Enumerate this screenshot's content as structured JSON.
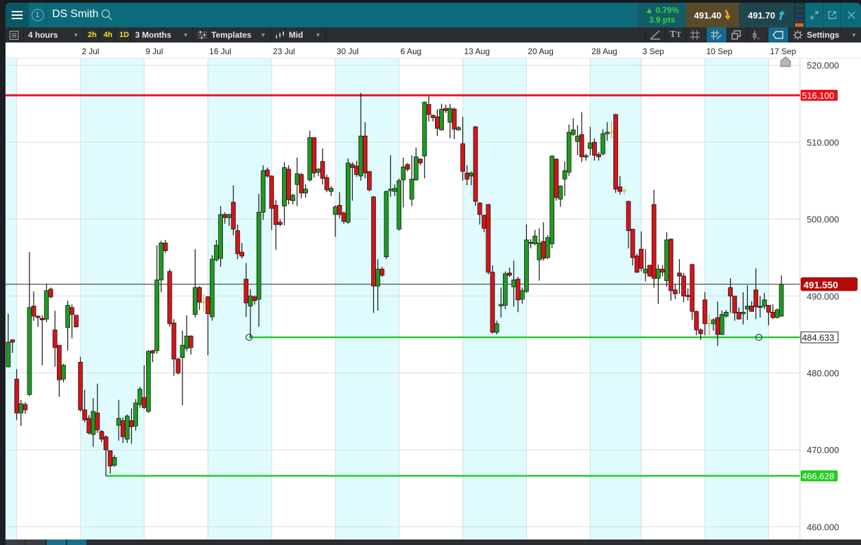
{
  "header": {
    "workspace_number": "1",
    "title": "DS Smith",
    "change_pct": "0.79%",
    "change_pts": "3.9 pts",
    "sell_price": "491.40",
    "buy_price": "491.70"
  },
  "toolbar": {
    "interval": "4 hours",
    "quick_intervals": [
      "2h",
      "4h",
      "1D"
    ],
    "range": "3 Months",
    "templates": "Templates",
    "price_type": "Mid",
    "settings": "Settings"
  },
  "colors": {
    "up": "#1f9a22",
    "down": "#d3151a",
    "doji": "#e0a030",
    "resistance": "#e8141c",
    "support": "#22cc22",
    "current": "#b30a0a",
    "band": "#dffbfd"
  },
  "chart_data": {
    "type": "candlestick",
    "title": "DS Smith",
    "timeframe": "4 hours",
    "x_ticks": [
      {
        "label": "2 Jul",
        "index": 17
      },
      {
        "label": "9 Jul",
        "index": 32
      },
      {
        "label": "16 Jul",
        "index": 47
      },
      {
        "label": "23 Jul",
        "index": 62
      },
      {
        "label": "30 Jul",
        "index": 77
      },
      {
        "label": "6 Aug",
        "index": 92
      },
      {
        "label": "13 Aug",
        "index": 107
      },
      {
        "label": "20 Aug",
        "index": 122
      },
      {
        "label": "28 Aug",
        "index": 137
      },
      {
        "label": "3 Sep",
        "index": 149
      },
      {
        "label": "10 Sep",
        "index": 164
      },
      {
        "label": "17 Sep",
        "index": 179
      }
    ],
    "y_ticks": [
      {
        "label": "520.000",
        "value": 520
      },
      {
        "label": "510.000",
        "value": 510
      },
      {
        "label": "500.000",
        "value": 500
      },
      {
        "label": "490.000",
        "value": 490
      },
      {
        "label": "480.000",
        "value": 480
      },
      {
        "label": "470.000",
        "value": 470
      },
      {
        "label": "460.000",
        "value": 460
      }
    ],
    "ylim": [
      458.35,
      520.9
    ],
    "current_price": {
      "label": "491.550",
      "value": 491.55
    },
    "levels": [
      {
        "label": "516.100",
        "value": 516.1,
        "kind": "resistance",
        "from_index": -1,
        "to_index": null
      },
      {
        "label": "484.633",
        "value": 484.633,
        "kind": "support",
        "from_index": 56.7,
        "to_index": null,
        "anchors": [
          56.7,
          176.7
        ]
      },
      {
        "label": "466.628",
        "value": 466.628,
        "kind": "support",
        "from_index": 23,
        "to_index": null
      }
    ],
    "candle_fields": [
      "open",
      "high",
      "low",
      "close"
    ],
    "candles": [
      [
        480.8,
        487.7,
        480.7,
        484.0
      ],
      [
        484.3,
        484.4,
        482.6,
        484.0
      ],
      [
        479.2,
        480.5,
        473.9,
        474.8
      ],
      [
        474.8,
        476.5,
        473.1,
        476.0
      ],
      [
        475.9,
        476.2,
        474.7,
        475.2
      ],
      [
        477.2,
        495.7,
        477.0,
        488.5
      ],
      [
        488.7,
        490.6,
        486.8,
        487.4
      ],
      [
        487.4,
        487.4,
        486.0,
        487.2
      ],
      [
        487.1,
        487.5,
        481.0,
        486.9
      ],
      [
        487.0,
        491.6,
        486.6,
        490.7
      ],
      [
        490.9,
        491.1,
        489.7,
        489.9
      ],
      [
        485.6,
        488.1,
        480.8,
        483.3
      ],
      [
        483.6,
        483.6,
        476.9,
        479.1
      ],
      [
        479.2,
        481.2,
        478.8,
        481.0
      ],
      [
        485.9,
        489.4,
        482.9,
        488.8
      ],
      [
        488.5,
        488.9,
        484.5,
        487.6
      ],
      [
        487.5,
        487.5,
        485.9,
        486.0
      ],
      [
        481.4,
        482.1,
        475.0,
        475.2
      ],
      [
        475.2,
        477.8,
        473.6,
        473.9
      ],
      [
        474.1,
        474.5,
        472.0,
        472.2
      ],
      [
        472.0,
        476.7,
        470.4,
        475.0
      ],
      [
        474.8,
        478.6,
        472.2,
        472.6
      ],
      [
        472.4,
        472.6,
        471.0,
        471.4
      ],
      [
        471.7,
        471.9,
        466.6,
        470.0
      ],
      [
        469.9,
        469.9,
        466.9,
        467.9
      ],
      [
        468.0,
        469.3,
        467.8,
        469.0
      ],
      [
        473.2,
        476.5,
        471.2,
        474.1
      ],
      [
        473.8,
        474.2,
        470.9,
        471.7
      ],
      [
        471.4,
        474.6,
        470.9,
        474.4
      ],
      [
        473.8,
        475.4,
        470.8,
        473.0
      ],
      [
        473.1,
        476.6,
        472.5,
        476.1
      ],
      [
        475.9,
        478.2,
        475.5,
        477.9
      ],
      [
        476.8,
        481.0,
        475.3,
        475.5
      ],
      [
        475.0,
        483.0,
        474.8,
        482.8
      ],
      [
        482.9,
        483.0,
        481.4,
        482.6
      ],
      [
        482.9,
        496.6,
        482.5,
        492.1
      ],
      [
        492.1,
        497.2,
        490.5,
        496.9
      ],
      [
        496.9,
        497.3,
        495.6,
        495.9
      ],
      [
        493.2,
        493.5,
        486.0,
        486.4
      ],
      [
        486.5,
        487.0,
        479.6,
        481.8
      ],
      [
        481.8,
        482.0,
        479.8,
        480.0
      ],
      [
        482.0,
        485.5,
        475.8,
        483.6
      ],
      [
        483.2,
        487.5,
        482.8,
        484.8
      ],
      [
        484.8,
        484.9,
        482.4,
        483.3
      ],
      [
        487.6,
        496.1,
        487.2,
        491.1
      ],
      [
        491.1,
        491.3,
        488.2,
        489.2
      ],
      [
        489.2,
        490.2,
        488.0,
        489.2
      ],
      [
        489.9,
        490.0,
        482.3,
        487.7
      ],
      [
        487.3,
        495.3,
        486.8,
        494.8
      ],
      [
        494.7,
        497.3,
        494.5,
        496.6
      ],
      [
        494.9,
        501.7,
        493.8,
        500.6
      ],
      [
        500.6,
        500.9,
        499.4,
        500.2
      ],
      [
        500.2,
        500.7,
        499.1,
        500.6
      ],
      [
        502.2,
        504.4,
        497.9,
        498.7
      ],
      [
        498.5,
        499.3,
        494.8,
        495.5
      ],
      [
        495.7,
        496.9,
        494.9,
        495.2
      ],
      [
        492.2,
        494.3,
        487.3,
        489.1
      ],
      [
        488.7,
        490.9,
        484.6,
        490.0
      ],
      [
        489.9,
        490.1,
        488.9,
        489.4
      ],
      [
        489.6,
        503.3,
        486.0,
        500.9
      ],
      [
        500.9,
        507.0,
        499.9,
        506.3
      ],
      [
        506.4,
        506.7,
        505.4,
        505.6
      ],
      [
        505.6,
        505.7,
        498.6,
        501.4
      ],
      [
        501.8,
        502.5,
        496.0,
        499.3
      ],
      [
        499.6,
        500.0,
        499.1,
        499.3
      ],
      [
        501.7,
        507.4,
        499.2,
        506.7
      ],
      [
        506.5,
        507.0,
        501.9,
        502.5
      ],
      [
        502.4,
        503.3,
        501.9,
        503.1
      ],
      [
        504.5,
        508.0,
        501.7,
        505.9
      ],
      [
        505.8,
        506.0,
        502.7,
        503.4
      ],
      [
        503.4,
        504.5,
        502.8,
        503.9
      ],
      [
        505.1,
        511.5,
        504.9,
        510.6
      ],
      [
        510.6,
        510.6,
        505.4,
        506.0
      ],
      [
        506.1,
        506.6,
        505.6,
        506.5
      ],
      [
        507.5,
        509.2,
        504.5,
        505.3
      ],
      [
        505.4,
        505.8,
        503.5,
        503.8
      ],
      [
        503.6,
        504.3,
        503.0,
        504.0
      ],
      [
        500.6,
        501.8,
        497.7,
        501.6
      ],
      [
        501.8,
        503.5,
        500.1,
        500.6
      ],
      [
        500.8,
        501.0,
        499.4,
        499.7
      ],
      [
        499.6,
        507.9,
        499.4,
        507.3
      ],
      [
        507.1,
        507.4,
        502.4,
        506.7
      ],
      [
        506.9,
        507.6,
        505.5,
        505.8
      ],
      [
        505.6,
        516.4,
        505.0,
        510.8
      ],
      [
        510.8,
        512.6,
        505.3,
        506.0
      ],
      [
        506.2,
        506.2,
        503.6,
        503.8
      ],
      [
        502.9,
        503.0,
        487.8,
        491.3
      ],
      [
        491.3,
        494.8,
        488.1,
        493.5
      ],
      [
        493.5,
        493.8,
        492.5,
        492.7
      ],
      [
        495.1,
        503.7,
        494.8,
        503.6
      ],
      [
        503.7,
        508.3,
        502.9,
        503.9
      ],
      [
        503.6,
        504.5,
        503.0,
        504.0
      ],
      [
        498.7,
        505.3,
        498.5,
        505.0
      ],
      [
        505.1,
        508.0,
        501.5,
        506.8
      ],
      [
        507.1,
        507.3,
        506.2,
        506.5
      ],
      [
        502.6,
        508.3,
        501.7,
        505.2
      ],
      [
        505.1,
        509.3,
        505.0,
        508.1
      ],
      [
        507.8,
        507.9,
        507.0,
        507.3
      ],
      [
        508.2,
        515.3,
        505.3,
        515.2
      ],
      [
        514.9,
        516.0,
        512.7,
        513.6
      ],
      [
        513.5,
        513.6,
        512.7,
        513.2
      ],
      [
        513.3,
        514.3,
        510.8,
        511.8
      ],
      [
        511.6,
        515.0,
        511.5,
        514.3
      ],
      [
        514.4,
        514.9,
        513.8,
        514.1
      ],
      [
        512.6,
        515.0,
        510.5,
        514.4
      ],
      [
        514.3,
        514.5,
        510.4,
        511.7
      ],
      [
        511.6,
        512.1,
        511.5,
        511.9
      ],
      [
        509.8,
        513.3,
        505.0,
        506.2
      ],
      [
        506.0,
        507.0,
        504.4,
        505.2
      ],
      [
        505.6,
        506.2,
        504.4,
        506.0
      ],
      [
        512.0,
        512.1,
        501.7,
        502.3
      ],
      [
        502.1,
        502.2,
        499.3,
        500.6
      ],
      [
        500.5,
        500.6,
        498.3,
        498.8
      ],
      [
        501.9,
        502.0,
        492.8,
        493.1
      ],
      [
        493.1,
        494.0,
        485.1,
        485.3
      ],
      [
        485.3,
        486.8,
        485.0,
        486.4
      ],
      [
        488.8,
        491.1,
        487.2,
        488.9
      ],
      [
        488.8,
        493.2,
        488.3,
        492.9
      ],
      [
        493.0,
        493.7,
        492.5,
        492.7
      ],
      [
        491.2,
        494.6,
        488.6,
        492.1
      ],
      [
        492.2,
        492.5,
        487.9,
        489.5
      ],
      [
        489.6,
        491.1,
        489.0,
        490.7
      ],
      [
        490.6,
        499.3,
        490.4,
        497.3
      ],
      [
        496.9,
        497.4,
        496.2,
        497.0
      ],
      [
        496.8,
        498.6,
        496.6,
        497.8
      ],
      [
        494.7,
        498.8,
        492.0,
        496.9
      ],
      [
        497.1,
        499.6,
        494.6,
        494.9
      ],
      [
        495.0,
        497.9,
        494.8,
        497.6
      ],
      [
        496.8,
        508.3,
        496.2,
        508.2
      ],
      [
        507.8,
        507.9,
        502.4,
        502.8
      ],
      [
        502.6,
        504.4,
        501.6,
        504.3
      ],
      [
        505.2,
        507.5,
        503.0,
        506.3
      ],
      [
        506.1,
        512.3,
        505.6,
        511.3
      ],
      [
        511.0,
        513.1,
        510.8,
        511.6
      ],
      [
        510.1,
        512.2,
        508.3,
        510.8
      ],
      [
        511.0,
        513.9,
        507.4,
        508.1
      ],
      [
        508.2,
        508.5,
        507.6,
        508.25
      ],
      [
        509.2,
        512.0,
        508.3,
        509.9
      ],
      [
        510.0,
        510.5,
        507.6,
        508.3
      ],
      [
        508.4,
        508.7,
        507.6,
        508.1
      ],
      [
        508.5,
        511.7,
        508.3,
        511.1
      ],
      [
        511.1,
        512.6,
        510.2,
        511.3
      ],
      [
        511.3,
        512.7,
        510.5,
        511.3
      ],
      [
        513.6,
        513.7,
        503.4,
        503.9
      ],
      [
        504.2,
        505.6,
        503.2,
        503.6
      ],
      [
        503.7,
        504.0,
        503.2,
        503.7
      ],
      [
        502.3,
        502.4,
        496.2,
        498.5
      ],
      [
        498.7,
        498.7,
        494.0,
        495.0
      ],
      [
        495.2,
        495.5,
        493.0,
        493.1
      ],
      [
        496.1,
        498.4,
        493.2,
        493.6
      ],
      [
        493.0,
        496.1,
        491.9,
        493.5
      ],
      [
        494.0,
        494.1,
        492.5,
        492.6
      ],
      [
        501.9,
        503.8,
        491.1,
        492.3
      ],
      [
        492.3,
        494.1,
        489.0,
        493.5
      ],
      [
        493.5,
        494.0,
        492.6,
        493.1
      ],
      [
        492.0,
        498.3,
        491.2,
        497.3
      ],
      [
        497.4,
        497.5,
        489.4,
        490.7
      ],
      [
        490.8,
        491.6,
        489.6,
        490.3
      ],
      [
        493.0,
        494.8,
        490.3,
        492.6
      ],
      [
        492.6,
        493.0,
        489.2,
        490.0
      ],
      [
        490.1,
        491.0,
        489.4,
        490.05
      ],
      [
        494.1,
        494.2,
        486.9,
        488.0
      ],
      [
        488.0,
        488.1,
        484.9,
        485.6
      ],
      [
        485.6,
        485.8,
        484.3,
        485.1
      ],
      [
        489.5,
        490.5,
        484.9,
        486.4
      ],
      [
        486.4,
        487.6,
        484.9,
        486.4
      ],
      [
        486.4,
        487.1,
        485.5,
        486.9
      ],
      [
        487.2,
        489.3,
        483.5,
        485.0
      ],
      [
        485.0,
        488.1,
        484.9,
        487.6
      ],
      [
        487.4,
        488.2,
        487.2,
        487.9
      ],
      [
        491.1,
        492.3,
        487.8,
        490.0
      ],
      [
        490.0,
        490.0,
        486.8,
        487.8
      ],
      [
        487.9,
        488.5,
        487.0,
        487.0
      ],
      [
        487.7,
        490.5,
        486.3,
        487.9
      ],
      [
        488.3,
        491.4,
        486.9,
        488.7
      ],
      [
        488.7,
        489.3,
        488.0,
        488.0
      ],
      [
        490.8,
        493.6,
        487.0,
        488.6
      ],
      [
        488.5,
        490.0,
        487.2,
        488.7
      ],
      [
        488.7,
        490.4,
        488.3,
        489.5
      ],
      [
        488.8,
        488.8,
        486.2,
        487.9
      ],
      [
        487.9,
        488.9,
        487.0,
        487.2
      ],
      [
        487.2,
        488.4,
        487.1,
        488.2
      ],
      [
        487.4,
        492.7,
        487.3,
        491.55
      ]
    ]
  }
}
